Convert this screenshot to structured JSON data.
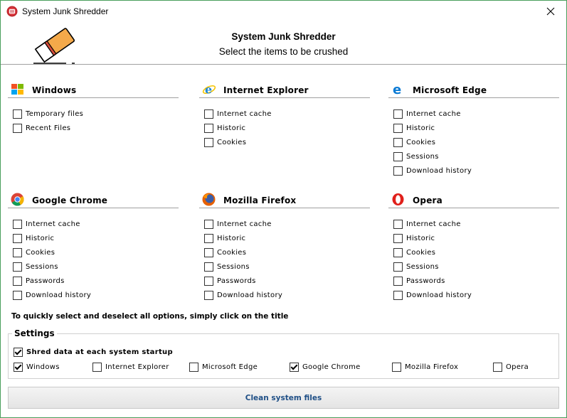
{
  "window": {
    "title": "System Junk Shredder",
    "close_glyph": "✕"
  },
  "header": {
    "title": "System Junk Shredder",
    "subtitle": "Select the items to be crushed"
  },
  "groups": [
    {
      "name": "Windows",
      "icon": "windows-icon",
      "options": [
        "Temporary files",
        "Recent Files"
      ]
    },
    {
      "name": "Internet Explorer",
      "icon": "internet-explorer-icon",
      "options": [
        "Internet cache",
        "Historic",
        "Cookies"
      ]
    },
    {
      "name": "Microsoft Edge",
      "icon": "microsoft-edge-icon",
      "options": [
        "Internet cache",
        "Historic",
        "Cookies",
        "Sessions",
        "Download history"
      ]
    },
    {
      "name": "Google Chrome",
      "icon": "google-chrome-icon",
      "options": [
        "Internet cache",
        "Historic",
        "Cookies",
        "Sessions",
        "Passwords",
        "Download history"
      ]
    },
    {
      "name": "Mozilla Firefox",
      "icon": "mozilla-firefox-icon",
      "options": [
        "Internet cache",
        "Historic",
        "Cookies",
        "Sessions",
        "Passwords",
        "Download history"
      ]
    },
    {
      "name": "Opera",
      "icon": "opera-icon",
      "options": [
        "Internet cache",
        "Historic",
        "Cookies",
        "Sessions",
        "Passwords",
        "Download history"
      ]
    }
  ],
  "hint": "To quickly select and deselect all options, simply click on the title",
  "settings": {
    "legend": "Settings",
    "startup_label": "Shred data at each system startup",
    "startup_checked": true,
    "targets": [
      {
        "label": "Windows",
        "checked": true
      },
      {
        "label": "Internet Explorer",
        "checked": false
      },
      {
        "label": "Microsoft Edge",
        "checked": false
      },
      {
        "label": "Google Chrome",
        "checked": true
      },
      {
        "label": "Mozilla Firefox",
        "checked": false
      },
      {
        "label": "Opera",
        "checked": false
      }
    ]
  },
  "clean_button": "Clean system files",
  "colors": {
    "accent_border": "#4a9e5c",
    "button_text": "#1f4f86"
  }
}
